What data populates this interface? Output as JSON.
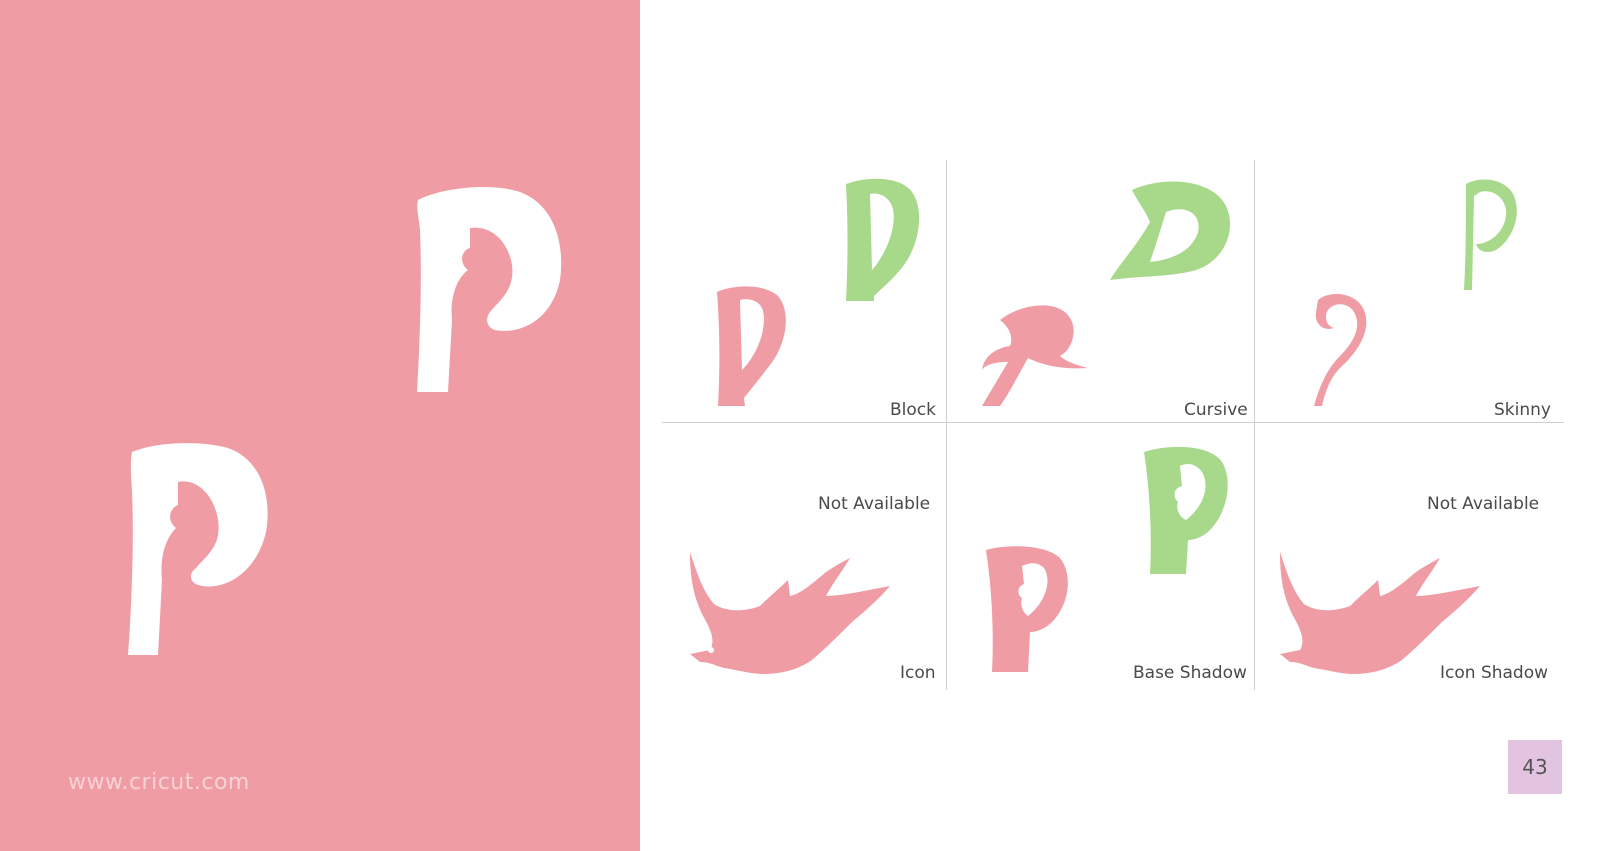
{
  "colors": {
    "pink": "#F09CA5",
    "green": "#A8D98A",
    "white": "#FFFFFF",
    "page_badge": "#E2C4E0"
  },
  "left": {
    "url": "www.cricut.com"
  },
  "cells": {
    "block": "Block",
    "cursive": "Cursive",
    "skinny": "Skinny",
    "icon": "Icon",
    "icon_na": "Not Available",
    "base_shadow": "Base Shadow",
    "icon_shadow": "Icon Shadow",
    "icon_shadow_na": "Not Available"
  },
  "page_number": "43"
}
